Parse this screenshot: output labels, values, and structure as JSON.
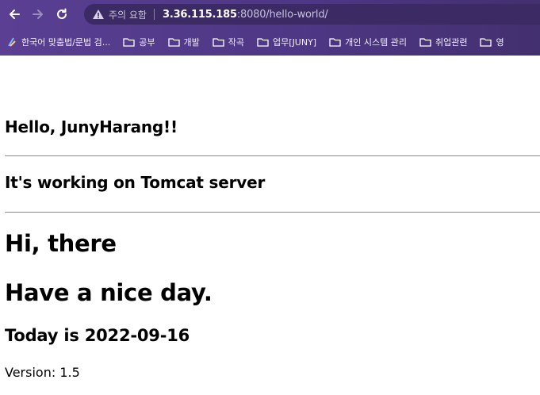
{
  "browser": {
    "security_label": "주의 요함",
    "url_host": "3.36.115.185",
    "url_rest": ":8080/hello-world/",
    "bookmarks": [
      {
        "label": "한국어 맞춤법/문법 검...",
        "icon": "spellcheck-icon"
      },
      {
        "label": "공부",
        "icon": "folder-icon"
      },
      {
        "label": "개발",
        "icon": "folder-icon"
      },
      {
        "label": "작곡",
        "icon": "folder-icon"
      },
      {
        "label": "업무[JUNY]",
        "icon": "folder-icon"
      },
      {
        "label": "개인 시스템 관리",
        "icon": "folder-icon"
      },
      {
        "label": "취업관련",
        "icon": "folder-icon"
      },
      {
        "label": "영",
        "icon": "folder-icon"
      }
    ],
    "colors": {
      "chrome": "#4e3785",
      "omnibox": "#3b2a63"
    }
  },
  "content": {
    "greeting": "Hello, JunyHarang!!",
    "server_line": "It's working on Tomcat server",
    "hi": "Hi, there",
    "nice_day": "Have a nice day.",
    "today": "Today is 2022-09-16",
    "version": "Version: 1.5"
  }
}
